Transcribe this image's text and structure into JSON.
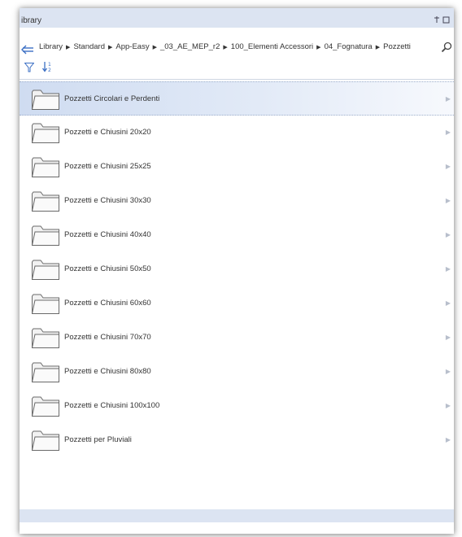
{
  "window": {
    "title": "ibrary",
    "pin_glyph": "⚲ ⊡"
  },
  "breadcrumb": {
    "back_icon": "back-arrow-icon",
    "items": [
      "Library",
      "Standard",
      "App-Easy",
      "_03_AE_MEP_r2",
      "100_Elementi Accessori",
      "04_Fognatura",
      "Pozzetti"
    ],
    "search_icon": "search-icon"
  },
  "toolbar": {
    "filter_icon": "filter-icon",
    "sort_icon": "sort-icon"
  },
  "folders": [
    {
      "label": "Pozzetti Circolari e Perdenti",
      "selected": true
    },
    {
      "label": "Pozzetti e Chiusini 20x20",
      "selected": false
    },
    {
      "label": "Pozzetti e Chiusini 25x25",
      "selected": false
    },
    {
      "label": "Pozzetti e Chiusini 30x30",
      "selected": false
    },
    {
      "label": "Pozzetti e Chiusini 40x40",
      "selected": false
    },
    {
      "label": "Pozzetti e Chiusini 50x50",
      "selected": false
    },
    {
      "label": "Pozzetti e Chiusini 60x60",
      "selected": false
    },
    {
      "label": "Pozzetti e Chiusini 70x70",
      "selected": false
    },
    {
      "label": "Pozzetti e Chiusini 80x80",
      "selected": false
    },
    {
      "label": "Pozzetti e Chiusini 100x100",
      "selected": false
    },
    {
      "label": "Pozzetti per Pluviali",
      "selected": false
    }
  ],
  "colors": {
    "accent": "#dce4f2",
    "selection": "#cfdcf1",
    "back_arrow": "#3b6fc4"
  }
}
